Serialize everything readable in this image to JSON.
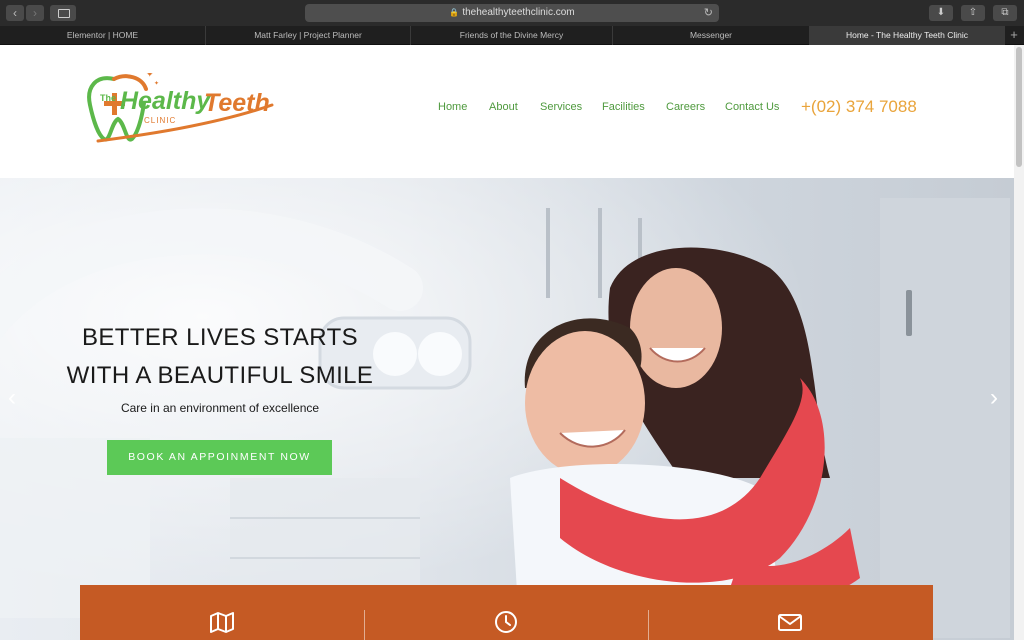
{
  "browser": {
    "url": "thehealthyteethclinic.com",
    "tabs": [
      {
        "label": "Elementor | HOME",
        "active": false
      },
      {
        "label": "Matt Farley | Project Planner",
        "active": false
      },
      {
        "label": "Friends of the Divine Mercy",
        "active": false
      },
      {
        "label": "Messenger",
        "active": false
      },
      {
        "label": "Home - The Healthy Teeth Clinic",
        "active": true
      }
    ]
  },
  "logo": {
    "the": "The",
    "healthy": "Healthy",
    "teeth": "Teeth",
    "clinic": "CLINIC"
  },
  "nav": {
    "items": [
      "Home",
      "About",
      "Services",
      "Facilities",
      "Careers",
      "Contact Us"
    ],
    "phone": "+(02) 374 7088"
  },
  "hero": {
    "title_line1": "BETTER LIVES STARTS",
    "title_line2": "WITH A BEAUTIFUL SMILE",
    "subtitle": "Care in an environment of excellence",
    "cta": "BOOK AN APPOINMENT NOW"
  },
  "infobar": {
    "icons": [
      "map-icon",
      "clock-icon",
      "envelope-icon"
    ]
  },
  "colors": {
    "nav_green": "#4f9a3e",
    "phone_orange": "#e9a43b",
    "cta_green": "#5cc957",
    "infobar_orange": "#c55a24"
  }
}
